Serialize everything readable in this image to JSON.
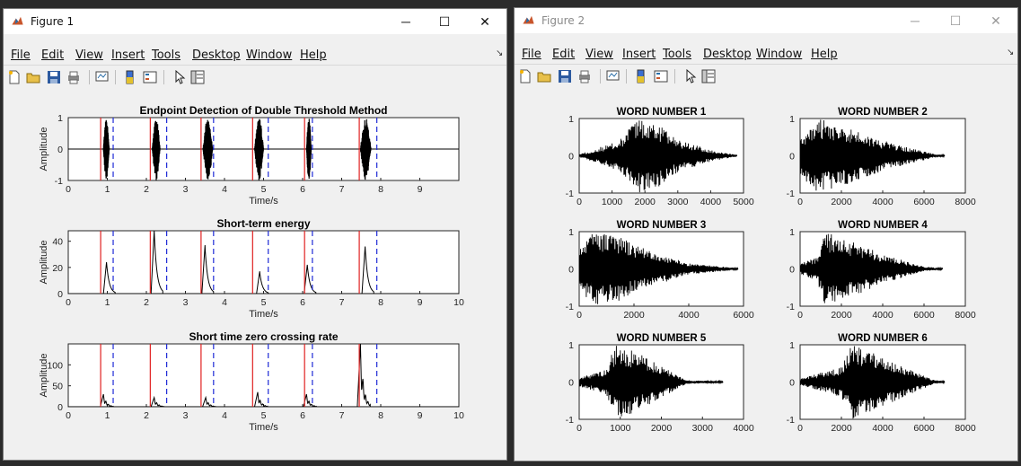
{
  "figure1": {
    "title": "Figure 1",
    "menu": [
      "File",
      "Edit",
      "View",
      "Insert",
      "Tools",
      "Desktop",
      "Window",
      "Help"
    ],
    "controls": {
      "minimize": "─",
      "maximize": "☐",
      "close": "✕"
    },
    "chart_data": [
      {
        "type": "line",
        "title": "Endpoint Detection of Double Threshold Method",
        "xlabel": "Time/s",
        "ylabel": "Amplitude",
        "xlim": [
          0,
          10
        ],
        "ylim": [
          -1,
          1
        ],
        "xticks": [
          "0",
          "1",
          "2",
          "3",
          "4",
          "5",
          "6",
          "7",
          "8",
          "9"
        ],
        "yticks": [
          "1",
          "0",
          "-1"
        ],
        "onsets": [
          0.83,
          2.1,
          3.4,
          4.72,
          6.05,
          7.45
        ],
        "offsets": [
          1.15,
          2.52,
          3.72,
          5.12,
          6.25,
          7.9
        ],
        "bursts": [
          [
            0.9,
            1.05
          ],
          [
            2.15,
            2.35
          ],
          [
            3.45,
            3.7
          ],
          [
            4.77,
            5.0
          ],
          [
            6.1,
            6.22
          ],
          [
            7.48,
            7.75
          ]
        ]
      },
      {
        "type": "line",
        "title": "Short-term energy",
        "xlabel": "Time/s",
        "ylabel": "Amplitude",
        "xlim": [
          0,
          10
        ],
        "ylim": [
          0,
          48
        ],
        "xticks": [
          "0",
          "1",
          "2",
          "3",
          "4",
          "5",
          "6",
          "7",
          "8",
          "9",
          "10"
        ],
        "yticks": [
          "40",
          "20",
          "0"
        ],
        "onsets": [
          0.83,
          2.1,
          3.4,
          4.72,
          6.05,
          7.45
        ],
        "offsets": [
          1.15,
          2.52,
          3.72,
          5.12,
          6.25,
          7.9
        ],
        "peaks": [
          [
            0.98,
            24
          ],
          [
            2.2,
            48
          ],
          [
            3.5,
            37
          ],
          [
            4.9,
            17
          ],
          [
            6.12,
            22
          ],
          [
            7.6,
            36
          ]
        ]
      },
      {
        "type": "line",
        "title": "Short time zero crossing rate",
        "xlabel": "Time/s",
        "ylabel": "Amplitude",
        "xlim": [
          0,
          10
        ],
        "ylim": [
          0,
          150
        ],
        "xticks": [
          "0",
          "1",
          "2",
          "3",
          "4",
          "5",
          "6",
          "7",
          "8",
          "9",
          "10"
        ],
        "yticks": [
          "100",
          "50",
          "0"
        ],
        "onsets": [
          0.83,
          2.1,
          3.4,
          4.72,
          6.05,
          7.45
        ],
        "offsets": [
          1.15,
          2.52,
          3.72,
          5.12,
          6.25,
          7.9
        ],
        "peaks": [
          [
            0.9,
            30
          ],
          [
            2.2,
            22
          ],
          [
            3.52,
            22
          ],
          [
            4.85,
            35
          ],
          [
            6.1,
            30
          ],
          [
            7.48,
            150
          ]
        ]
      }
    ]
  },
  "figure2": {
    "title": "Figure 2",
    "menu": [
      "File",
      "Edit",
      "View",
      "Insert",
      "Tools",
      "Desktop",
      "Window",
      "Help"
    ],
    "controls": {
      "minimize": "─",
      "maximize": "☐",
      "close": "✕"
    },
    "chart_data": [
      {
        "type": "line",
        "title": "WORD NUMBER 1",
        "xlim": [
          0,
          5000
        ],
        "ylim": [
          -1,
          1
        ],
        "xticks": [
          "0",
          "1000",
          "2000",
          "3000",
          "4000",
          "5000"
        ],
        "yticks": [
          "1",
          "0",
          "-1"
        ],
        "length": 4800,
        "env": [
          [
            0,
            0.04
          ],
          [
            1200,
            0.4
          ],
          [
            1800,
            1.0
          ],
          [
            2400,
            0.85
          ],
          [
            3000,
            0.45
          ],
          [
            4000,
            0.15
          ],
          [
            4800,
            0.02
          ]
        ]
      },
      {
        "type": "line",
        "title": "WORD NUMBER 2",
        "xlim": [
          0,
          8000
        ],
        "ylim": [
          -1,
          1
        ],
        "xticks": [
          "0",
          "2000",
          "4000",
          "6000",
          "8000"
        ],
        "yticks": [
          "1",
          "0",
          "-1"
        ],
        "length": 7000,
        "env": [
          [
            0,
            0.5
          ],
          [
            800,
            1.0
          ],
          [
            2000,
            0.85
          ],
          [
            3500,
            0.5
          ],
          [
            5000,
            0.25
          ],
          [
            6500,
            0.05
          ],
          [
            7000,
            0.02
          ]
        ]
      },
      {
        "type": "line",
        "title": "WORD NUMBER 3",
        "xlim": [
          0,
          6000
        ],
        "ylim": [
          -1,
          1
        ],
        "xticks": [
          "0",
          "2000",
          "4000",
          "6000"
        ],
        "yticks": [
          "1",
          "0",
          "-1"
        ],
        "length": 5800,
        "env": [
          [
            0,
            0.5
          ],
          [
            500,
            1.0
          ],
          [
            1500,
            0.85
          ],
          [
            2500,
            0.5
          ],
          [
            4000,
            0.15
          ],
          [
            5800,
            0.02
          ]
        ]
      },
      {
        "type": "line",
        "title": "WORD NUMBER 4",
        "xlim": [
          0,
          8000
        ],
        "ylim": [
          -1,
          1
        ],
        "xticks": [
          "0",
          "2000",
          "4000",
          "6000",
          "8000"
        ],
        "yticks": [
          "1",
          "0",
          "-1"
        ],
        "length": 6900,
        "env": [
          [
            0,
            0.15
          ],
          [
            800,
            0.3
          ],
          [
            1200,
            1.0
          ],
          [
            2500,
            0.75
          ],
          [
            4000,
            0.4
          ],
          [
            6000,
            0.06
          ],
          [
            6900,
            0.02
          ]
        ]
      },
      {
        "type": "line",
        "title": "WORD NUMBER 5",
        "xlim": [
          0,
          4000
        ],
        "ylim": [
          -1,
          1
        ],
        "xticks": [
          "0",
          "1000",
          "2000",
          "3000",
          "4000"
        ],
        "yticks": [
          "1",
          "0",
          "-1"
        ],
        "length": 3500,
        "env": [
          [
            0,
            0.12
          ],
          [
            600,
            0.3
          ],
          [
            900,
            1.0
          ],
          [
            1500,
            0.75
          ],
          [
            2200,
            0.3
          ],
          [
            2600,
            0.05
          ],
          [
            3500,
            0.02
          ]
        ]
      },
      {
        "type": "line",
        "title": "WORD NUMBER 6",
        "xlim": [
          0,
          8000
        ],
        "ylim": [
          -1,
          1
        ],
        "xticks": [
          "0",
          "2000",
          "4000",
          "6000",
          "8000"
        ],
        "yticks": [
          "1",
          "0",
          "-1"
        ],
        "length": 7000,
        "env": [
          [
            0,
            0.1
          ],
          [
            1000,
            0.25
          ],
          [
            2000,
            0.4
          ],
          [
            2500,
            1.0
          ],
          [
            3500,
            0.8
          ],
          [
            5000,
            0.4
          ],
          [
            6500,
            0.05
          ],
          [
            7000,
            0.02
          ]
        ]
      }
    ]
  }
}
